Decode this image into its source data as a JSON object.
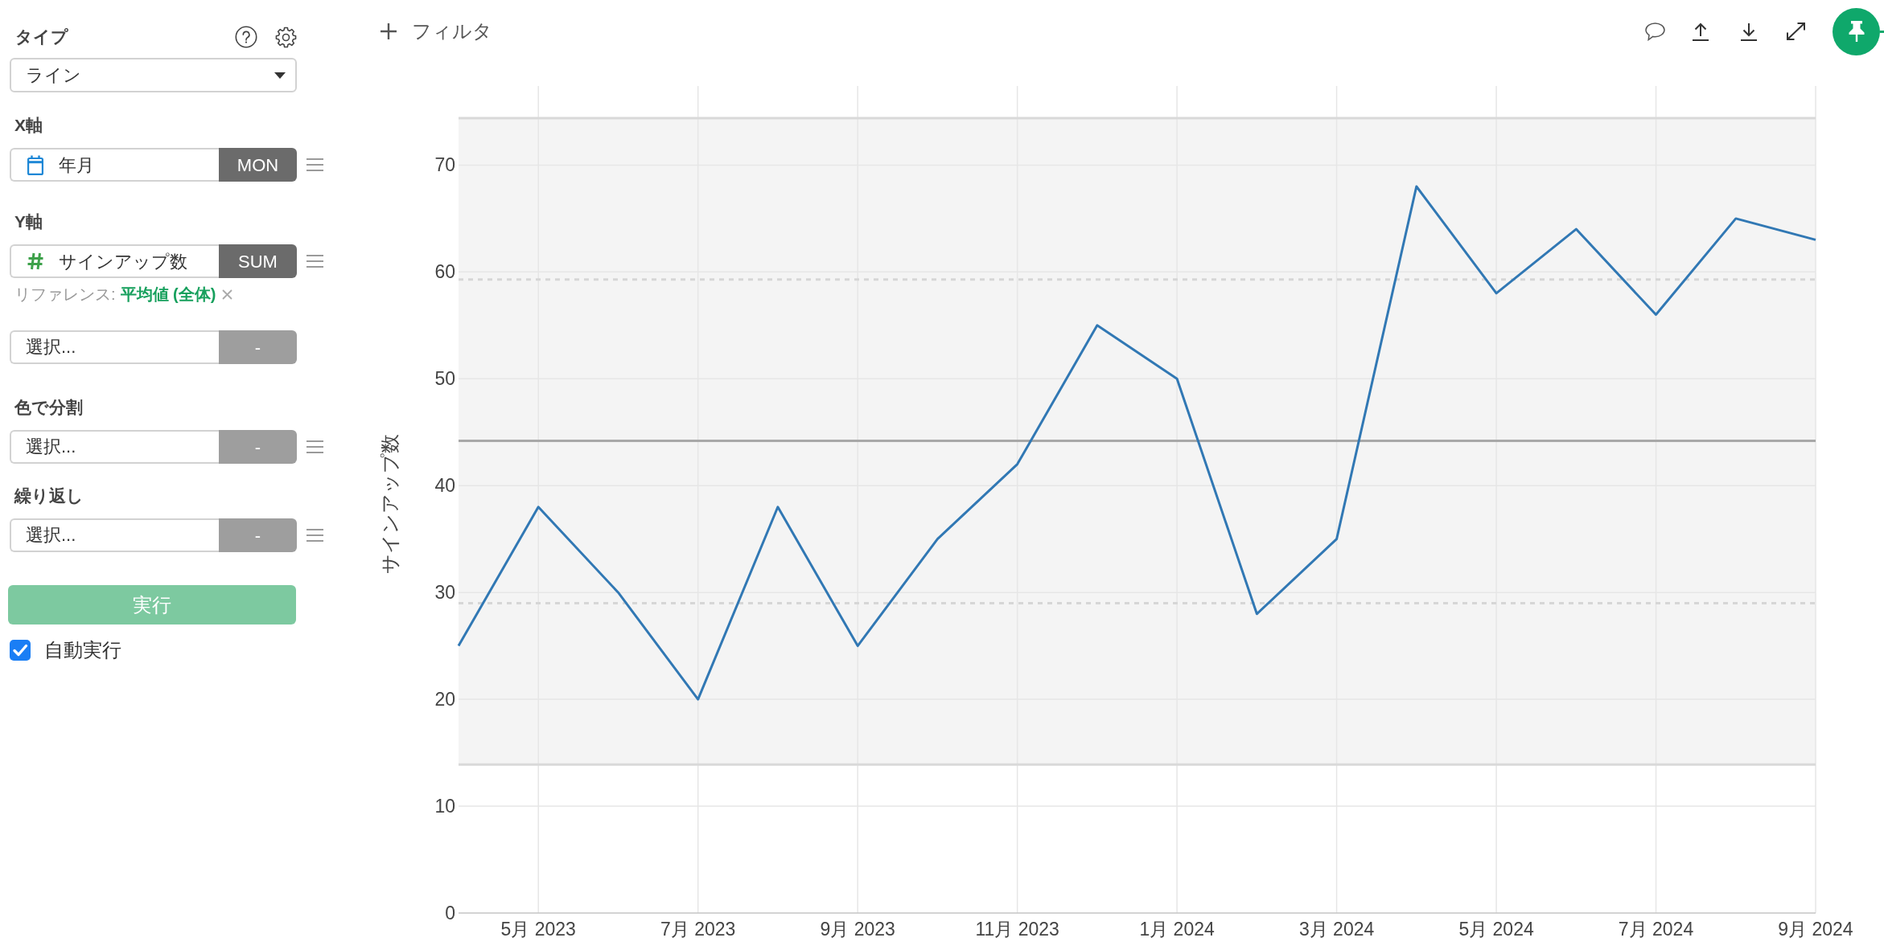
{
  "sidebar": {
    "chart_type": {
      "label": "タイプ",
      "value": "ライン"
    },
    "fields": [
      {
        "label": "X軸",
        "kind": "date",
        "value": "年月",
        "aggregation": "MON",
        "has_menu": true
      },
      {
        "label": "Y軸",
        "kind": "number",
        "value": "サインアップ数",
        "aggregation": "SUM",
        "has_menu": true,
        "reference": {
          "label": "リファレンス:",
          "value": "平均値 (全体)"
        }
      },
      {
        "kind": "empty",
        "placeholder": "選択...",
        "aggregation": "-",
        "has_menu": false
      },
      {
        "label": "色で分割",
        "kind": "empty",
        "placeholder": "選択...",
        "aggregation": "-",
        "has_menu": true
      },
      {
        "label": "繰り返し",
        "kind": "empty",
        "placeholder": "選択...",
        "aggregation": "-",
        "has_menu": true
      }
    ],
    "run_button": {
      "label": "実行",
      "disabled": true
    },
    "auto_run": {
      "label": "自動実行",
      "checked": true
    }
  },
  "toolbar": {
    "filter_button": {
      "label": "フィルタ"
    }
  },
  "chart": {
    "chart_data": {
      "type": "line",
      "ylabel": "サインアップ数",
      "categories": [
        null,
        "5月 2023",
        null,
        "7月 2023",
        null,
        "9月 2023",
        null,
        "11月 2023",
        null,
        "1月 2024",
        null,
        "3月 2024",
        null,
        "5月 2024",
        null,
        "7月 2024",
        null,
        "9月 2024"
      ],
      "series": [
        {
          "color": "#3178b4",
          "values": [
            25,
            38,
            30,
            20,
            38,
            25,
            35,
            42,
            55,
            50,
            28,
            35,
            68,
            58,
            64,
            56,
            65,
            63
          ]
        }
      ],
      "ylim": [
        0,
        77.4
      ],
      "yticks": [
        0,
        10,
        20,
        30,
        40,
        50,
        60,
        70
      ],
      "grid": true,
      "bands": [
        {
          "axis": "y",
          "from": 13.9,
          "to": 74.4
        }
      ],
      "ref_lines": [
        {
          "axis": "y",
          "value": 74.4,
          "color": "#d9d9d9"
        },
        {
          "axis": "y",
          "value": 59.3,
          "color": "#d6d6d6"
        },
        {
          "axis": "y",
          "value": 44.2,
          "color": "#a8a8a8"
        },
        {
          "axis": "y",
          "value": 29.0,
          "color": "#d6d6d6"
        },
        {
          "axis": "y",
          "value": 13.9,
          "color": "#d9d9d9"
        }
      ]
    }
  }
}
